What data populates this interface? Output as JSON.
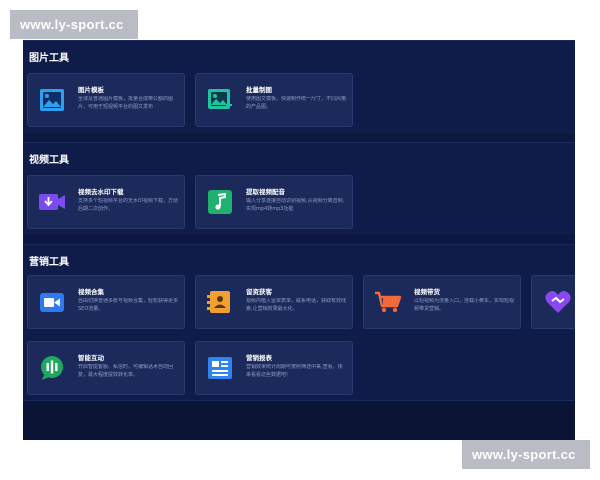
{
  "watermark": {
    "top": "www.ly-sport.cc",
    "bottom": "www.ly-sport.cc"
  },
  "sections": [
    {
      "title": "图片工具",
      "cards": [
        {
          "title": "图片模板",
          "desc": "全球及普通图片模板，批量合成带公都的图片，可用于短视频平台的图文发布",
          "icon": "image-icon"
        },
        {
          "title": "批量制图",
          "desc": "使用图文模板，快速制作统一尺寸，不同风格的产品图。",
          "icon": "image-add-icon"
        }
      ]
    },
    {
      "title": "视频工具",
      "cards": [
        {
          "title": "视频去水印下载",
          "desc": "支持多个短视频平台的无水印视频下载，方便后期二次创作。",
          "icon": "video-download-icon"
        },
        {
          "title": "提取视频配音",
          "desc": "输入分享连接自动识别视频,从视频分离音频,实现mp4转mp3功能",
          "icon": "music-note-icon"
        }
      ]
    },
    {
      "title": "营销工具",
      "cards": [
        {
          "title": "视频合集",
          "desc": "自由切换普通多账号视频合集，轻松获得更多SEO流量。",
          "icon": "video-camera-icon"
        },
        {
          "title": "留资获客",
          "desc": "视频内植入留资表单，联系电话，获取有效线索,让营销效果最大化。",
          "icon": "contact-card-icon"
        },
        {
          "title": "视频带货",
          "desc": "以短视频为流量入口，挂载小黄车，实现短视频带货营销。",
          "icon": "shopping-cart-icon"
        },
        {
          "title": "",
          "desc": "",
          "icon": "heart-icon"
        },
        {
          "title": "智能互动",
          "desc": "开启智能客服、私信时，可编辑话术自动回复，最大程度提效转化率。",
          "icon": "chat-bubble-icon"
        },
        {
          "title": "营销报表",
          "desc": "营销效果统计周期可按照筛选中来,查看，快来看看这些数据吧!",
          "icon": "report-icon"
        }
      ]
    }
  ],
  "colors": {
    "background": "#0d1740",
    "card": "#1b2a5a",
    "image-icon": "#2ea0f0",
    "image-add-icon": "#1ec6a0",
    "video-download-icon": "#7a4cf0",
    "music-note-icon": "#20b070",
    "video-camera-icon": "#2f7af0",
    "contact-card-icon": "#f0a030",
    "shopping-cart-icon": "#f06a3c",
    "heart-icon": "#8a48f0",
    "chat-bubble-icon": "#1ea860",
    "report-icon": "#2f84f0"
  }
}
